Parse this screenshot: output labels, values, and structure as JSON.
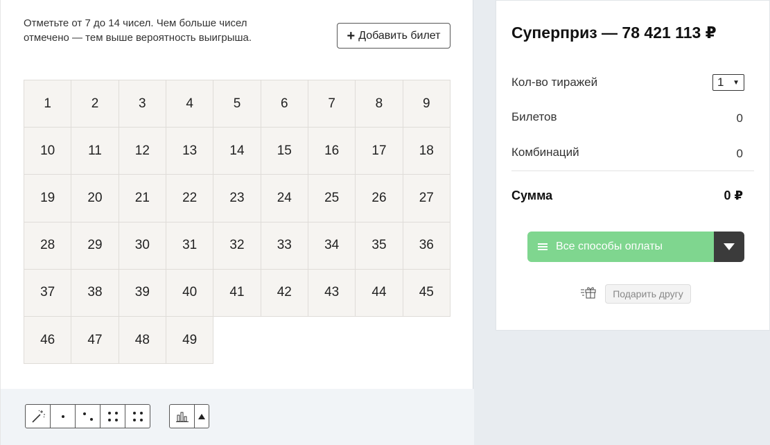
{
  "ticket": {
    "instruction_line1": "Отметьте от 7 до 14 чисел. Чем больше чисел",
    "instruction_line2": "отмечено — тем выше вероятность выигрыша.",
    "add_ticket_label": "Добавить билет",
    "numbers": [
      "1",
      "2",
      "3",
      "4",
      "5",
      "6",
      "7",
      "8",
      "9",
      "10",
      "11",
      "12",
      "13",
      "14",
      "15",
      "16",
      "17",
      "18",
      "19",
      "20",
      "21",
      "22",
      "23",
      "24",
      "25",
      "26",
      "27",
      "28",
      "29",
      "30",
      "31",
      "32",
      "33",
      "34",
      "35",
      "36",
      "37",
      "38",
      "39",
      "40",
      "41",
      "42",
      "43",
      "44",
      "45",
      "46",
      "47",
      "48",
      "49"
    ]
  },
  "toolbar": {
    "tools": [
      "magic-wand-icon",
      "one-dot-icon",
      "two-dots-icon",
      "four-dots-icon",
      "four-dots-alt-icon"
    ],
    "stats_icon": "bar-chart-icon",
    "arrow_icon": "triangle-up-icon"
  },
  "summary": {
    "super_prize": "Суперприз —  78 421 113 ₽",
    "draws_label": "Кол-во тиражей",
    "draws_value": "1",
    "tickets_label": "Билетов",
    "tickets_value": "0",
    "combinations_label": "Комбинаций",
    "combinations_value": "0",
    "sum_label": "Сумма",
    "sum_value": "0 ₽",
    "pay_label": "Все способы оплаты",
    "gift_label": "Подарить другу"
  },
  "colors": {
    "pay_button": "#7fd68f",
    "pay_dropdown": "#3b3b3b",
    "cell_bg": "#f6f4f1"
  }
}
